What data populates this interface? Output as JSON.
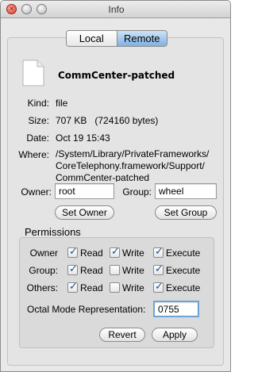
{
  "window": {
    "title": "Info"
  },
  "tabs": [
    {
      "label": "Local",
      "selected": false
    },
    {
      "label": "Remote",
      "selected": true
    }
  ],
  "file": {
    "name": "CommCenter-patched",
    "kind_label": "Kind:",
    "kind": "file",
    "size_label": "Size:",
    "size": "707 KB   (724160 bytes)",
    "date_label": "Date:",
    "date": "Oct 19 15:43",
    "where_label": "Where:",
    "where_lines": [
      "/System/Library/PrivateFrameworks/",
      "CoreTelephony.framework/Support/",
      "CommCenter-patched"
    ]
  },
  "owner": {
    "label": "Owner:",
    "value": "root",
    "button": "Set Owner"
  },
  "group": {
    "label": "Group:",
    "value": "wheel",
    "button": "Set Group"
  },
  "permissions": {
    "title": "Permissions",
    "column_labels": {
      "read": "Read",
      "write": "Write",
      "execute": "Execute"
    },
    "rows": [
      {
        "label": "Owner",
        "read": true,
        "write": true,
        "execute": true
      },
      {
        "label": "Group:",
        "read": true,
        "write": false,
        "execute": true
      },
      {
        "label": "Others:",
        "read": true,
        "write": false,
        "execute": true
      }
    ],
    "octal_label": "Octal Mode Representation:",
    "octal_value": "0755",
    "revert": "Revert",
    "apply": "Apply"
  }
}
